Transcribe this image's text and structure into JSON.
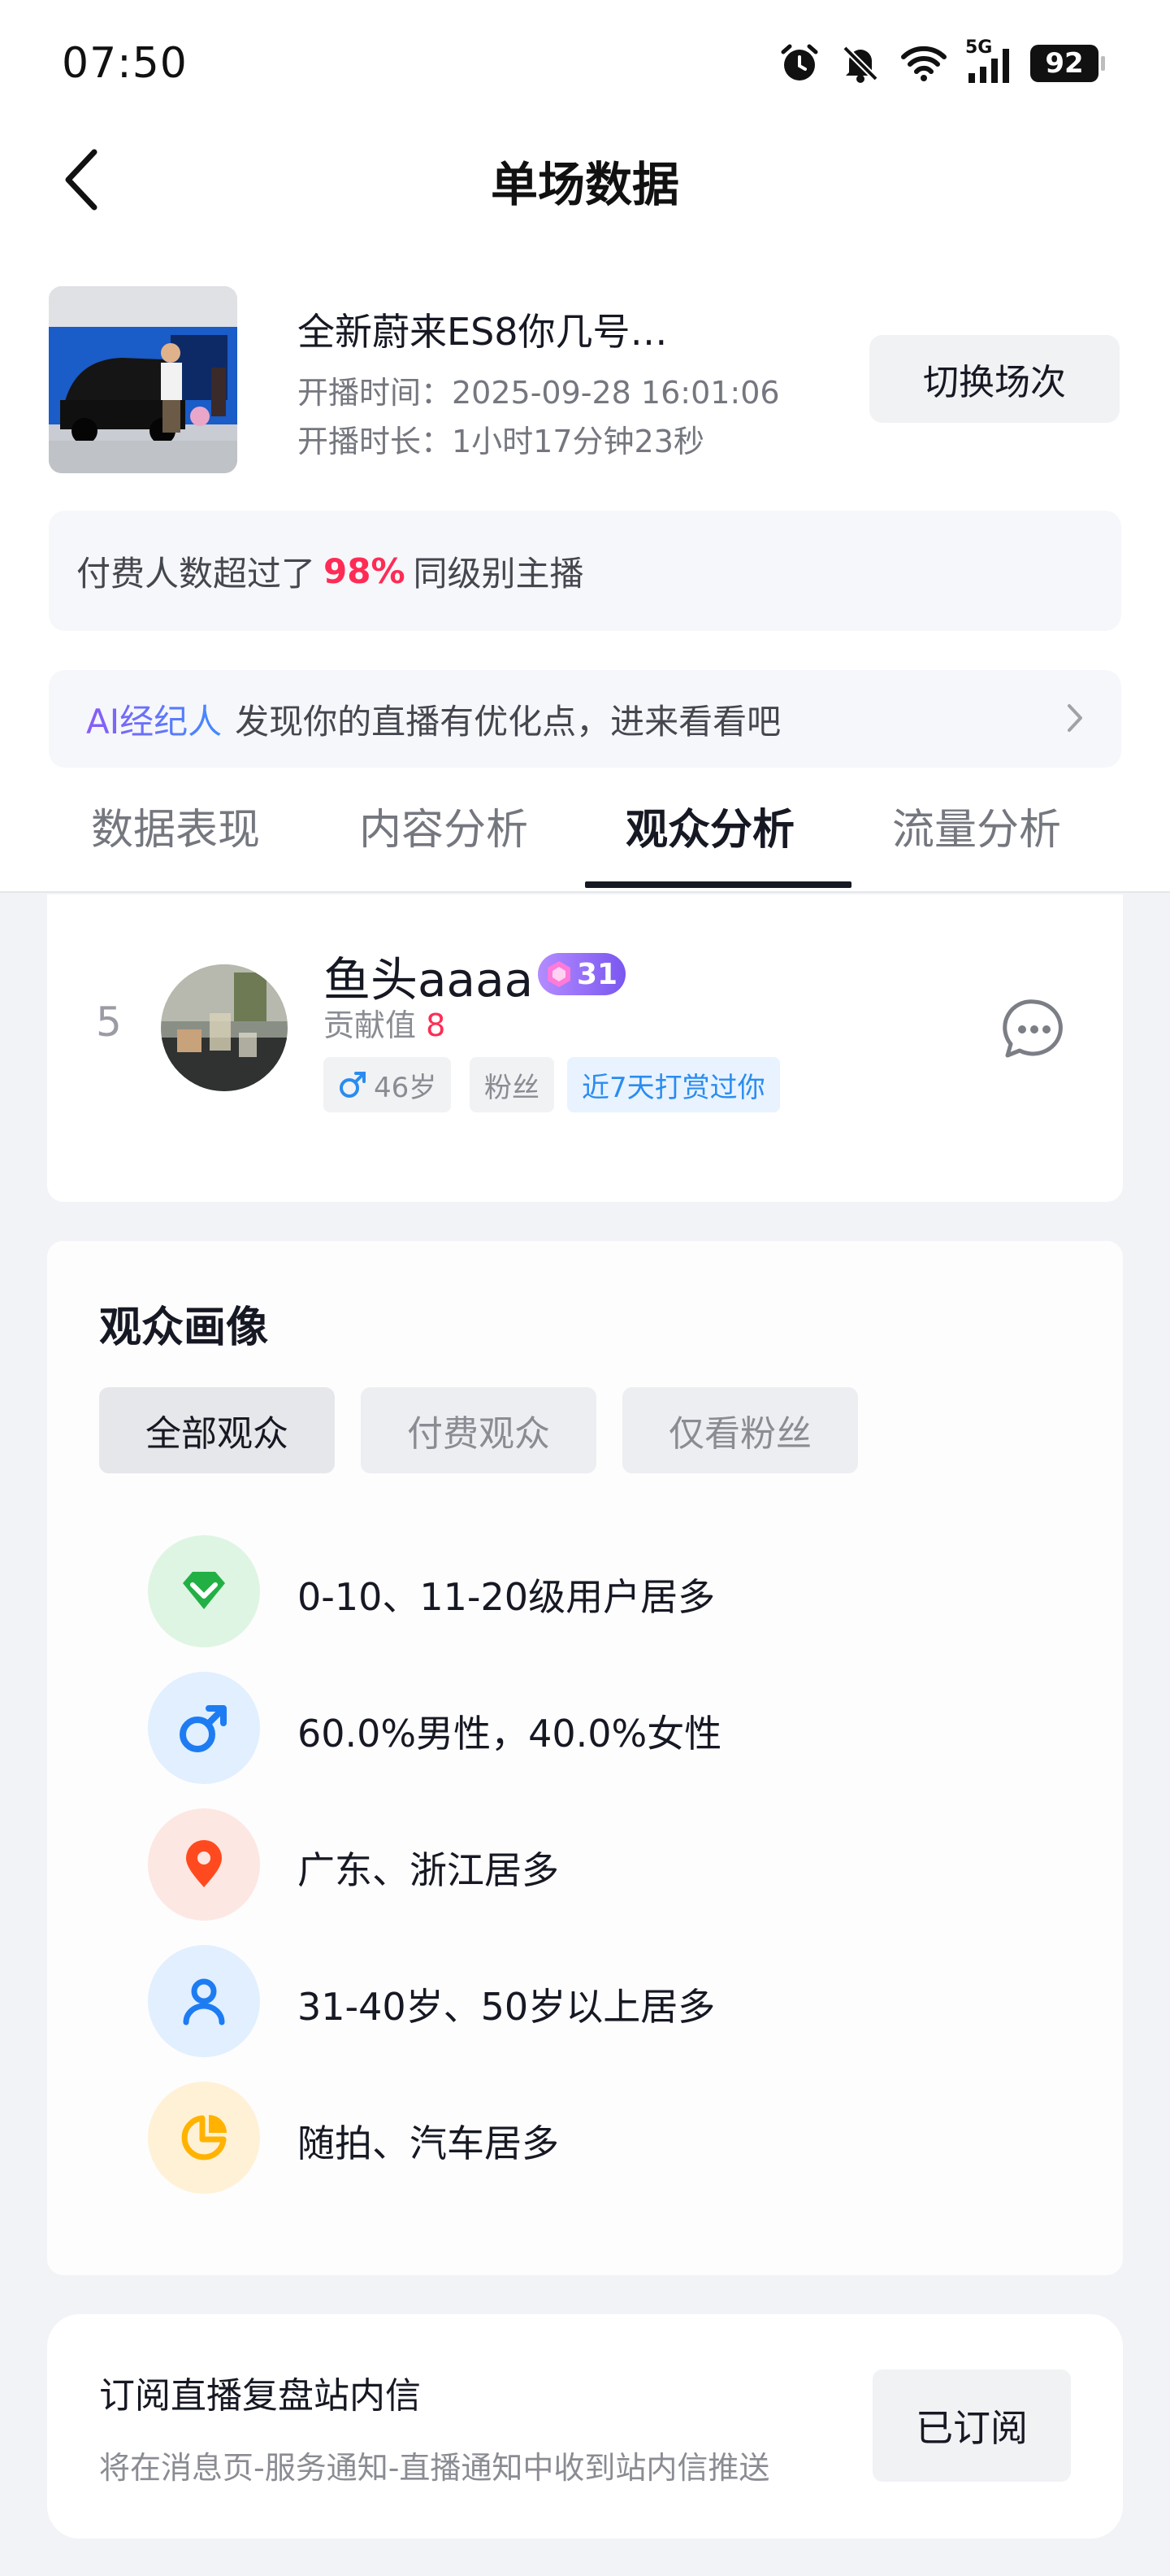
{
  "status_bar": {
    "time": "07:50",
    "network": "5G",
    "battery": "92",
    "icons": [
      "alarm-icon",
      "mute-icon",
      "wifi-icon",
      "signal-5g-icon",
      "battery-icon"
    ]
  },
  "header": {
    "title": "单场数据",
    "back_icon": "chevron-left-icon"
  },
  "live_session": {
    "title": "全新蔚来ES8你几号…",
    "start_time": "开播时间：2025-09-28 16:01:06",
    "duration": "开播时长：1小时17分钟23秒",
    "switch_button": "切换场次"
  },
  "rank_banner": {
    "prefix": "付费人数超过了",
    "percent": "98%",
    "suffix": "同级别主播"
  },
  "ai_banner": {
    "tag": "AI经纪人",
    "text": "发现你的直播有优化点，进来看看吧"
  },
  "tabs": [
    {
      "label": "数据表现",
      "active": false
    },
    {
      "label": "内容分析",
      "active": false
    },
    {
      "label": "观众分析",
      "active": true
    },
    {
      "label": "流量分析",
      "active": false
    }
  ],
  "viewer": {
    "rank": "5",
    "name": "鱼头aaaa",
    "level": "31",
    "contribution_label": "贡献值",
    "contribution_value": "8",
    "chips": {
      "gender_age": "46岁",
      "fan": "粉丝",
      "tipped": "近7天打赏过你"
    }
  },
  "portrait": {
    "title": "观众画像",
    "segments": [
      {
        "label": "全部观众",
        "active": true
      },
      {
        "label": "付费观众",
        "active": false
      },
      {
        "label": "仅看粉丝",
        "active": false
      }
    ],
    "traits": [
      {
        "icon": "diamond-level-icon",
        "text": "0-10、11-20级用户居多",
        "bg": "#dff5e3",
        "color": "#22b045"
      },
      {
        "icon": "male-gender-icon",
        "text": "60.0%男性，40.0%女性",
        "bg": "#e1efff",
        "color": "#1d7cf2"
      },
      {
        "icon": "location-pin-icon",
        "text": "广东、浙江居多",
        "bg": "#fde7e2",
        "color": "#ff4a1f"
      },
      {
        "icon": "person-icon",
        "text": "31-40岁、50岁以上居多",
        "bg": "#e1efff",
        "color": "#1d7cf2"
      },
      {
        "icon": "pie-chart-icon",
        "text": "随拍、汽车居多",
        "bg": "#fff1d6",
        "color": "#ffb300"
      }
    ]
  },
  "subscribe": {
    "title": "订阅直播复盘站内信",
    "desc": "将在消息页-服务通知-直播通知中收到站内信推送",
    "button": "已订阅"
  }
}
